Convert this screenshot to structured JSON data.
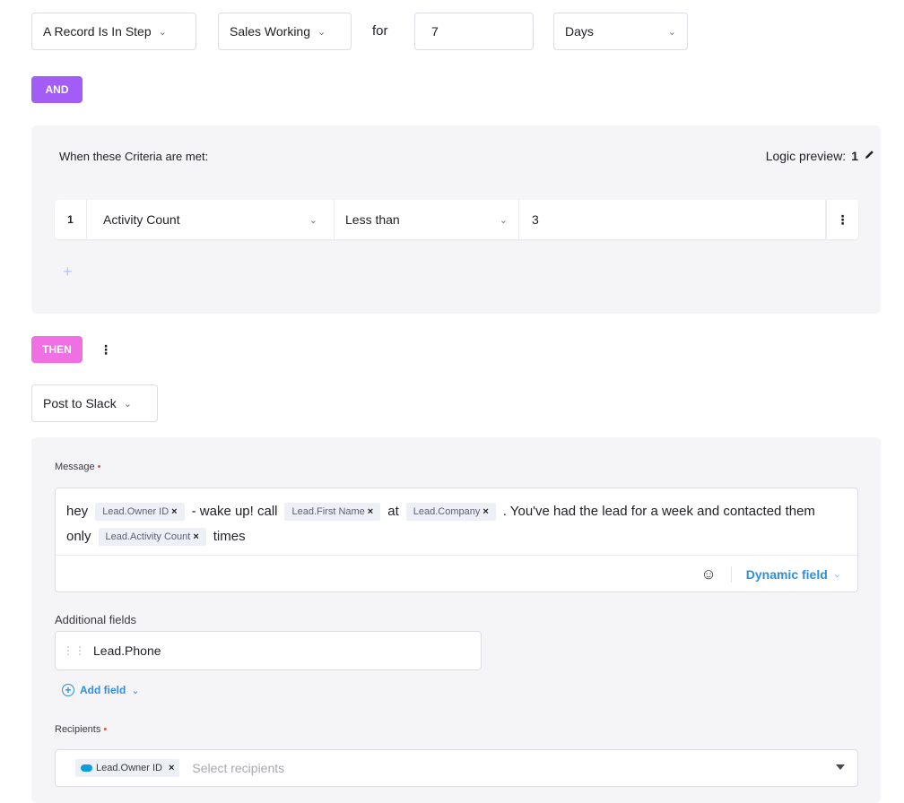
{
  "trigger": {
    "condition": "A Record Is In Step",
    "step": "Sales Working",
    "for_label": "for",
    "duration": "7",
    "unit": "Days"
  },
  "and_label": "AND",
  "criteria": {
    "title": "When these Criteria are met:",
    "logic_label": "Logic preview:",
    "logic_value": "1",
    "rows": [
      {
        "index": "1",
        "field": "Activity Count",
        "operator": "Less than",
        "value": "3"
      }
    ],
    "add_symbol": "+"
  },
  "then_label": "THEN",
  "action": {
    "type": "Post to Slack",
    "message_label": "Message",
    "message": {
      "t1": "hey",
      "c1": "Lead.Owner ID",
      "t2": "- wake up! call",
      "c2": "Lead.First Name",
      "t3": "at",
      "c3": "Lead.Company",
      "t4": ". You've had the lead for a week and contacted them only",
      "c4": "Lead.Activity Count",
      "t5": "times"
    },
    "dynamic_field_label": "Dynamic field",
    "additional_fields_label": "Additional fields",
    "additional_fields": [
      "Lead.Phone"
    ],
    "add_field_label": "Add field",
    "recipients_label": "Recipients",
    "recipients": [
      "Lead.Owner ID"
    ],
    "recipients_placeholder": "Select recipients"
  },
  "colors": {
    "and": "#a35cf5",
    "then": "#f06fe3",
    "link": "#2f8fdb",
    "required": "#f0472d"
  }
}
